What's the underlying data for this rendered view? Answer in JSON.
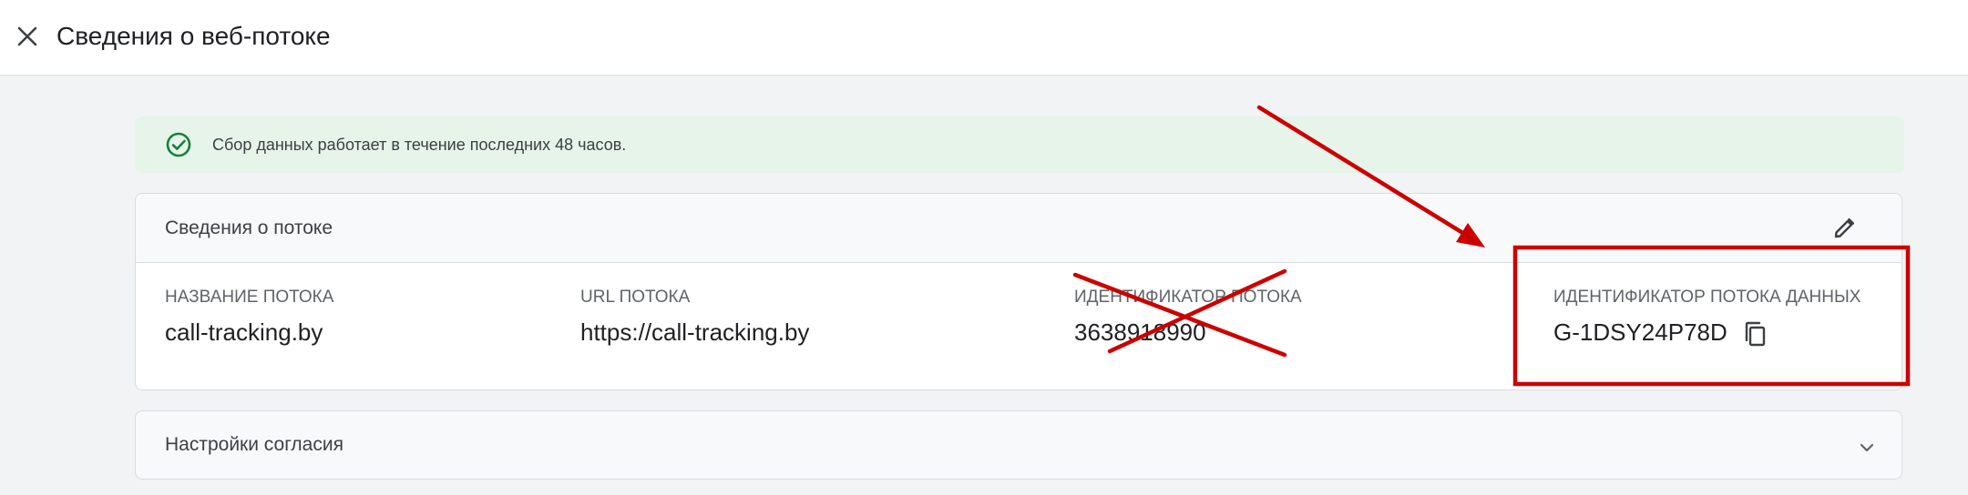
{
  "header": {
    "title": "Сведения о веб-потоке",
    "close_icon": "close-icon"
  },
  "banner": {
    "text": "Сбор данных работает в течение последних 48 часов.",
    "icon": "check-circle-icon",
    "color": "#e6f4ea",
    "icon_color": "#188038"
  },
  "stream_details": {
    "title": "Сведения о потоке",
    "edit_icon": "pencil-icon",
    "fields": [
      {
        "label": "НАЗВАНИЕ ПОТОКА",
        "value": "call-tracking.by"
      },
      {
        "label": "URL ПОТОКА",
        "value": "https://call-tracking.by"
      },
      {
        "label": "ИДЕНТИФИКАТОР ПОТОКА",
        "value": "3638918990"
      },
      {
        "label": "ИДЕНТИФИКАТОР ПОТОКА ДАННЫХ",
        "value": "G-1DSY24P78D"
      }
    ],
    "copy_icon": "copy-icon"
  },
  "consent": {
    "title": "Настройки согласия",
    "chevron_icon": "chevron-down-icon"
  },
  "annotations": {
    "color": "#cc0000",
    "cross_mark": "x-cross-mark",
    "arrow": "arrow",
    "highlight_box": "highlight-box"
  }
}
